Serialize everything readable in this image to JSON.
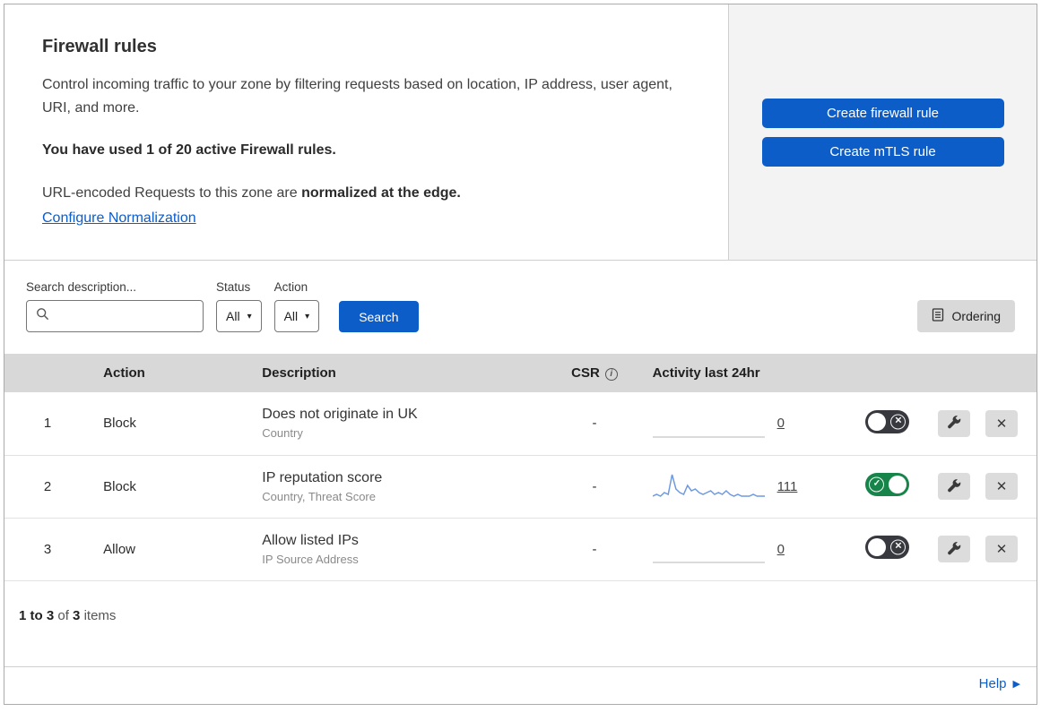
{
  "colors": {
    "primary": "#0d5dc9",
    "toggle_on": "#17854a",
    "toggle_off": "#38383f",
    "sparkline": "#6f9ae0",
    "table_header_bg": "#d8d8d8"
  },
  "icons": {
    "caret": "▾",
    "close": "✕",
    "check": "✓",
    "info": "i",
    "help_arrow": "▶"
  },
  "intro": {
    "title": "Firewall rules",
    "description": "Control incoming traffic to your zone by filtering requests based on location, IP address, user agent, URI, and more.",
    "usage": "You have used 1 of 20 active Firewall rules.",
    "normalization_prefix": "URL-encoded Requests to this zone are ",
    "normalization_bold": "normalized at the edge.",
    "normalization_link": "Configure Normalization"
  },
  "actions": {
    "create_firewall_rule": "Create firewall rule",
    "create_mtls_rule": "Create mTLS rule"
  },
  "filters": {
    "search_label": "Search description...",
    "search_value": "",
    "status_label": "Status",
    "status_value": "All",
    "action_label": "Action",
    "action_value": "All",
    "search_button": "Search",
    "ordering_button": "Ordering"
  },
  "table": {
    "headers": {
      "action": "Action",
      "description": "Description",
      "csr": "CSR",
      "activity": "Activity last 24hr"
    },
    "rows": [
      {
        "num": "1",
        "action": "Block",
        "description": "Does not originate in UK",
        "fields": "Country",
        "csr": "-",
        "activity": "0",
        "enabled": false,
        "sparkline": [
          0,
          0,
          0,
          0,
          0,
          0,
          0,
          0,
          0,
          0
        ]
      },
      {
        "num": "2",
        "action": "Block",
        "description": "IP reputation score",
        "fields": "Country, Threat Score",
        "csr": "-",
        "activity": "111",
        "enabled": true,
        "sparkline": [
          2,
          3,
          2,
          4,
          3,
          14,
          6,
          4,
          3,
          8,
          5,
          6,
          4,
          3,
          4,
          5,
          3,
          4,
          3,
          5,
          3,
          2,
          3,
          2,
          2,
          2,
          3,
          2,
          2,
          2
        ]
      },
      {
        "num": "3",
        "action": "Allow",
        "description": "Allow listed IPs",
        "fields": "IP Source Address",
        "csr": "-",
        "activity": "0",
        "enabled": false,
        "sparkline": [
          0,
          0,
          0,
          0,
          0,
          0,
          0,
          0,
          0,
          0
        ]
      }
    ]
  },
  "footer": {
    "range": "1 to 3",
    "of": "of",
    "total": "3",
    "items": "items",
    "help": "Help"
  }
}
